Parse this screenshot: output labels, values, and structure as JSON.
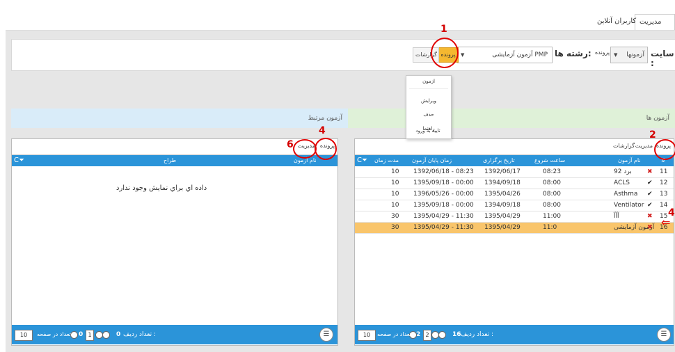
{
  "tabs": {
    "active": "مدیریت آزمون",
    "online": "کاربران آنلاین"
  },
  "toolbar": {
    "site_label": "سایت :",
    "site_value": "آزمونها",
    "file_label_small": "پرونده",
    "fields_label": "رشته ها:",
    "exam_value": "آزمون آزمایشی PMP",
    "file_button": "پرونده",
    "reports_button": "گزارشات"
  },
  "dropdown": {
    "items": [
      "ازمون",
      "ویرایش",
      "حذف",
      "راهنما",
      "تایید به ورود"
    ]
  },
  "left_panel": {
    "title": "آزمون ها",
    "grid_tools": {
      "file": "پرونده",
      "manage": "مدیریت",
      "reports": "گزارشات"
    },
    "columns": [
      "#",
      "نام آزمون",
      "ساعت شروع",
      "تاریخ برگزاری",
      "زمان پایان آزمون",
      "مدت زمان"
    ],
    "rows": [
      {
        "id": "11",
        "name": "برد 92",
        "status": "x",
        "start": "08:23",
        "date": "1392/06/17",
        "end": "1392/06/18 - 08:23",
        "duration": "10"
      },
      {
        "id": "12",
        "name": "ACLS",
        "status": "v",
        "start": "08:00",
        "date": "1394/09/18",
        "end": "1395/09/18 - 00:00",
        "duration": "10"
      },
      {
        "id": "13",
        "name": "Asthma",
        "status": "v",
        "start": "08:00",
        "date": "1395/04/26",
        "end": "1396/05/26 - 00:00",
        "duration": "10"
      },
      {
        "id": "14",
        "name": "Ventilator",
        "status": "v",
        "start": "08:00",
        "date": "1394/09/18",
        "end": "1395/09/18 - 00:00",
        "duration": "10"
      },
      {
        "id": "15",
        "name": "آآآ",
        "status": "x",
        "start": "11:00",
        "date": "1395/04/29",
        "end": "1395/04/29 - 11:30",
        "duration": "30"
      },
      {
        "id": "16",
        "name": "آزمون آزمایشی",
        "status": "x",
        "start": "11:0",
        "date": "1395/04/29",
        "end": "1395/04/29 - 11:30",
        "duration": "30",
        "selected": true
      }
    ],
    "footer": {
      "rows_label": "تعداد ردیف :",
      "rows_count": "16",
      "page_total": "2",
      "page_current": "2",
      "per_page_label": "تعداد در صفحه",
      "per_page": "10"
    }
  },
  "right_panel": {
    "title": "آزمون مرتبط",
    "grid_tools": {
      "file": "پرونده",
      "manage": "مدیریت"
    },
    "columns": [
      "نام آزمون",
      "طراح"
    ],
    "empty_message": "داده اي براي نمايش وجود ندارد",
    "footer": {
      "rows_label": "تعداد ردیف :",
      "rows_count": "0",
      "page_total": "0",
      "page_current": "1",
      "per_page_label": "تعداد در صفحه",
      "per_page": "10"
    }
  },
  "annotations": {
    "a1": "1",
    "a2": "2",
    "a4_left": "4",
    "a4_right": "4",
    "a6": "6"
  },
  "colors": {
    "header_blue": "#2b94d9",
    "selected_row": "#f9c56b",
    "annotation_red": "#e00000",
    "left_panel_head": "#dff1d8",
    "right_panel_head": "#d9ecf9"
  }
}
